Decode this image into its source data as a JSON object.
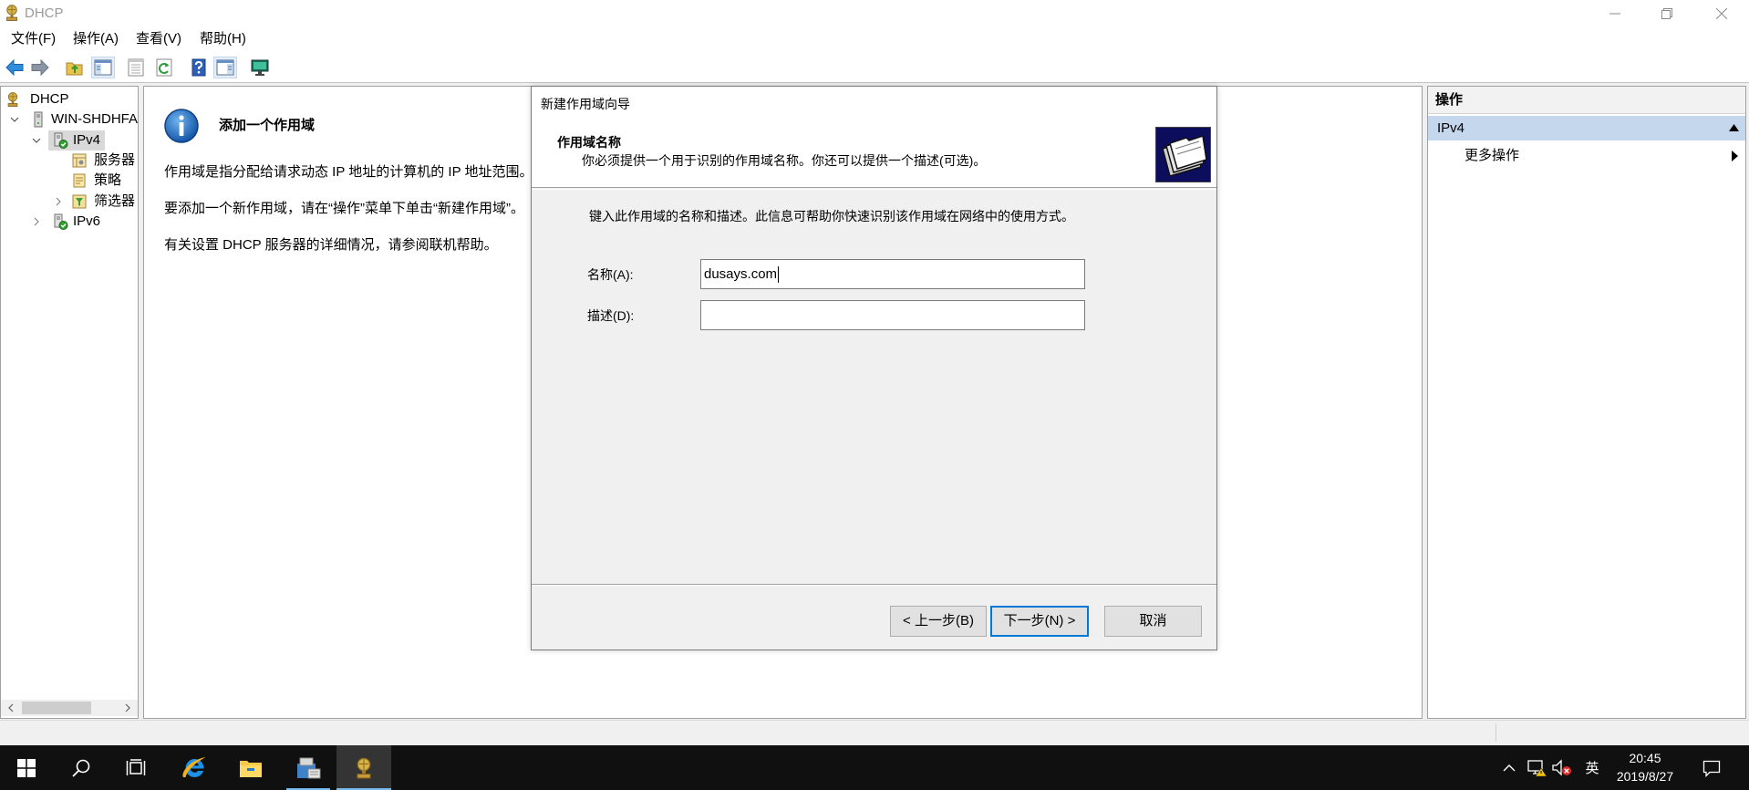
{
  "window": {
    "title": "DHCP",
    "icon": "dhcp-app-icon",
    "controls": [
      "minimize-icon",
      "restore-icon",
      "close-icon"
    ]
  },
  "menu": {
    "items": [
      "文件(F)",
      "操作(A)",
      "查看(V)",
      "帮助(H)"
    ]
  },
  "toolbar": {
    "buttons": [
      {
        "icon": "back-arrow-icon"
      },
      {
        "icon": "forward-arrow-icon"
      },
      {
        "icon": "up-one-level-icon"
      },
      {
        "icon": "show-hide-console-tree-icon",
        "pressed": true
      },
      {
        "icon": "export-list-icon"
      },
      {
        "icon": "refresh-icon"
      },
      {
        "icon": "help-icon"
      },
      {
        "icon": "show-hide-action-pane-icon",
        "pressed": true
      },
      {
        "icon": "display-statistics-icon"
      }
    ]
  },
  "tree": {
    "items": [
      {
        "label": "DHCP",
        "icon": "dhcp-root-icon"
      },
      {
        "label": "WIN-SHDHFA",
        "icon": "server-icon",
        "expanded": true
      },
      {
        "label": "IPv4",
        "icon": "ipv4-icon",
        "expanded": true,
        "selected": true
      },
      {
        "label": "服务器",
        "icon": "server-options-icon"
      },
      {
        "label": "策略",
        "icon": "policies-icon"
      },
      {
        "label": "筛选器",
        "icon": "filters-icon",
        "expanded": false
      },
      {
        "label": "IPv6",
        "icon": "ipv6-icon",
        "expanded": false
      }
    ]
  },
  "content": {
    "icon": "info-icon",
    "heading": "添加一个作用域",
    "paragraphs": [
      "作用域是指分配给请求动态 IP 地址的计算机的 IP 地址范围。",
      "要添加一个新作用域，请在“操作”菜单下单击“新建作用域”。",
      "有关设置 DHCP 服务器的详细情况，请参阅联机帮助。"
    ]
  },
  "actions": {
    "header": "操作",
    "section": "IPv4",
    "items": [
      "更多操作"
    ]
  },
  "dialog": {
    "title": "新建作用域向导",
    "page_title": "作用域名称",
    "page_subtitle": "你必须提供一个用于识别的作用域名称。你还可以提供一个描述(可选)。",
    "icon": "wizard-folders-icon",
    "intro": "键入此作用域的名称和描述。此信息可帮助你快速识别该作用域在网络中的使用方式。",
    "name_label": "名称(A):",
    "name_value": "dusays.com",
    "description_label": "描述(D):",
    "buttons": {
      "back": "< 上一步(B)",
      "next": "下一步(N) >",
      "cancel": "取消"
    }
  },
  "taskbar": {
    "apps": [
      {
        "icon": "windows-start-icon"
      },
      {
        "icon": "search-icon"
      },
      {
        "icon": "task-view-icon"
      },
      {
        "icon": "internet-explorer-icon"
      },
      {
        "icon": "file-explorer-icon"
      },
      {
        "icon": "server-manager-icon",
        "running": true
      },
      {
        "icon": "dhcp-app-icon",
        "running": true,
        "active": true
      }
    ],
    "tray": {
      "icons": [
        "show-hidden-icons-chevron-icon",
        "network-warning-icon",
        "volume-muted-icon",
        "action-center-icon"
      ],
      "ime": "英",
      "time": "20:45",
      "date": "2019/8/27"
    }
  },
  "colors": {
    "accent": "#0078d7",
    "selection_section": "#c5d7ed",
    "taskbar": "#101010",
    "wizard_icon_bg": "#0d0d5e"
  }
}
